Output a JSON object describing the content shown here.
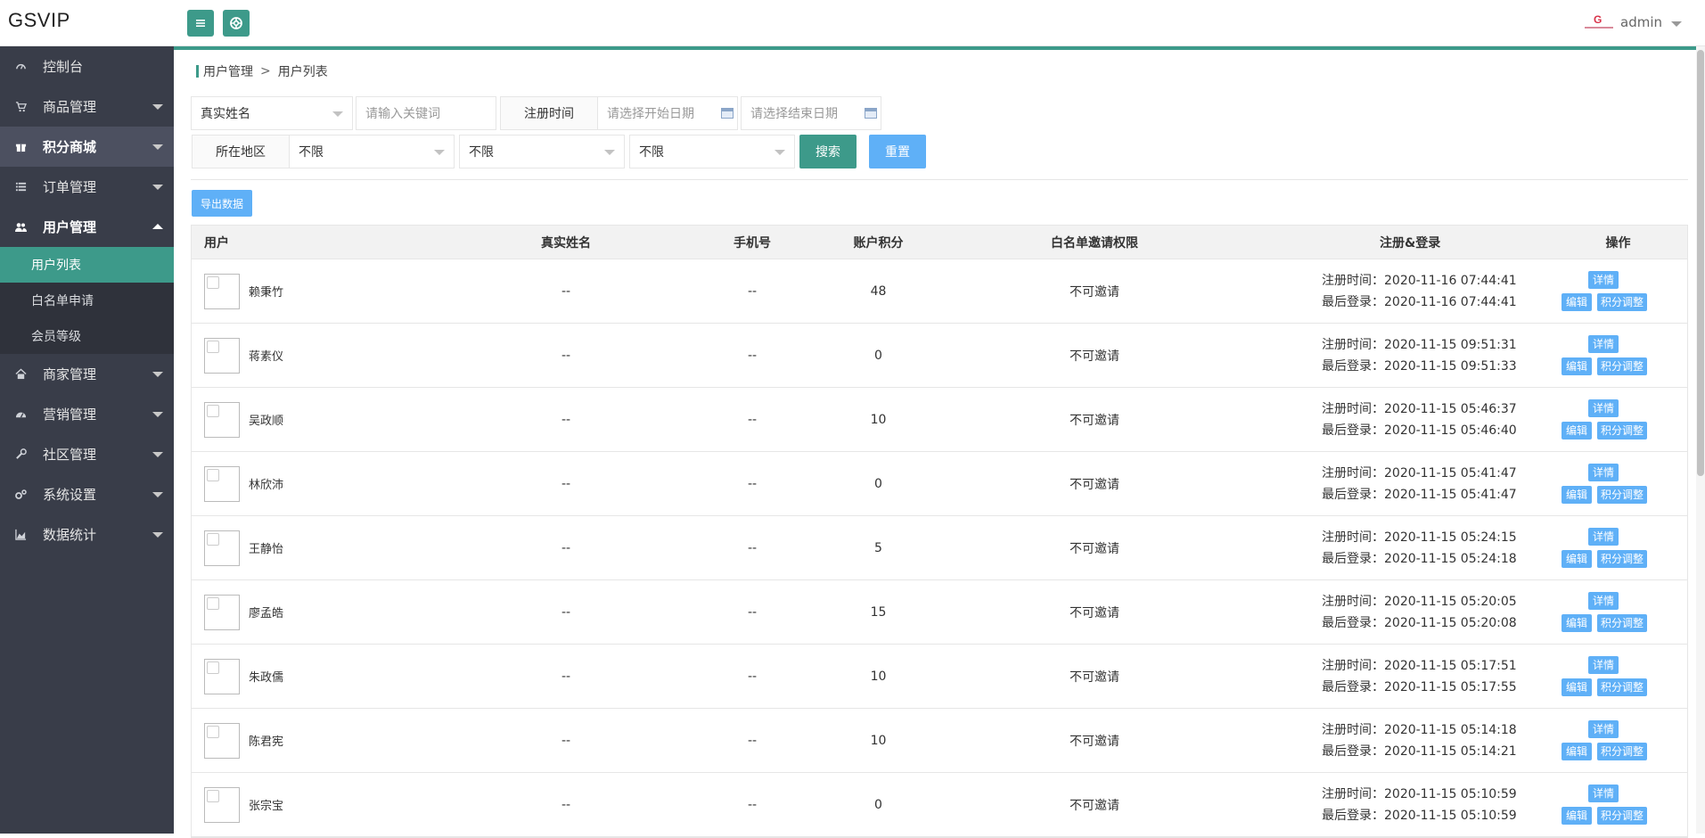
{
  "app": {
    "logo": "GSVIP",
    "user": "admin"
  },
  "sidebar": {
    "items": [
      {
        "label": "控制台",
        "icon": "dashboard-icon",
        "expandable": false
      },
      {
        "label": "商品管理",
        "icon": "cart-icon",
        "expandable": true
      },
      {
        "label": "积分商城",
        "icon": "gift-icon",
        "expandable": true
      },
      {
        "label": "订单管理",
        "icon": "list-icon",
        "expandable": true
      },
      {
        "label": "用户管理",
        "icon": "users-icon",
        "expandable": true,
        "open": true,
        "children": [
          "用户列表",
          "白名单申请",
          "会员等级"
        ]
      },
      {
        "label": "商家管理",
        "icon": "home-icon",
        "expandable": true
      },
      {
        "label": "营销管理",
        "icon": "gauge-icon",
        "expandable": true
      },
      {
        "label": "社区管理",
        "icon": "wrench-icon",
        "expandable": true
      },
      {
        "label": "系统设置",
        "icon": "gears-icon",
        "expandable": true
      },
      {
        "label": "数据统计",
        "icon": "area-chart-icon",
        "expandable": true
      }
    ]
  },
  "breadcrumb": {
    "parent": "用户管理",
    "sep": ">",
    "current": "用户列表"
  },
  "filters": {
    "field_select": "真实姓名",
    "keyword_placeholder": "请输入关键词",
    "reg_time_label": "注册时间",
    "start_date_placeholder": "请选择开始日期",
    "end_date_placeholder": "请选择结束日期",
    "region_label": "所在地区",
    "province": "不限",
    "city": "不限",
    "district": "不限",
    "search_button": "搜索",
    "reset_button": "重置"
  },
  "export_button": "导出数据",
  "table": {
    "headers": {
      "user": "用户",
      "name": "真实姓名",
      "phone": "手机号",
      "points": "账户积分",
      "perm": "白名单邀请权限",
      "reg": "注册&登录",
      "op": "操作"
    },
    "reg_prefix": "注册时间：",
    "login_prefix": "最后登录：",
    "op_detail": "详情",
    "op_edit": "编辑",
    "op_points": "积分调整",
    "rows": [
      {
        "user": "赖秉竹",
        "name": "--",
        "phone": "--",
        "points": "48",
        "perm": "不可邀请",
        "reg": "2020-11-16 07:44:41",
        "login": "2020-11-16 07:44:41"
      },
      {
        "user": "蒋素仪",
        "name": "--",
        "phone": "--",
        "points": "0",
        "perm": "不可邀请",
        "reg": "2020-11-15 09:51:31",
        "login": "2020-11-15 09:51:33"
      },
      {
        "user": "吴政顺",
        "name": "--",
        "phone": "--",
        "points": "10",
        "perm": "不可邀请",
        "reg": "2020-11-15 05:46:37",
        "login": "2020-11-15 05:46:40"
      },
      {
        "user": "林欣沛",
        "name": "--",
        "phone": "--",
        "points": "0",
        "perm": "不可邀请",
        "reg": "2020-11-15 05:41:47",
        "login": "2020-11-15 05:41:47"
      },
      {
        "user": "王静怡",
        "name": "--",
        "phone": "--",
        "points": "5",
        "perm": "不可邀请",
        "reg": "2020-11-15 05:24:15",
        "login": "2020-11-15 05:24:18"
      },
      {
        "user": "廖孟皓",
        "name": "--",
        "phone": "--",
        "points": "15",
        "perm": "不可邀请",
        "reg": "2020-11-15 05:20:05",
        "login": "2020-11-15 05:20:08"
      },
      {
        "user": "朱政儒",
        "name": "--",
        "phone": "--",
        "points": "10",
        "perm": "不可邀请",
        "reg": "2020-11-15 05:17:51",
        "login": "2020-11-15 05:17:55"
      },
      {
        "user": "陈君宪",
        "name": "--",
        "phone": "--",
        "points": "10",
        "perm": "不可邀请",
        "reg": "2020-11-15 05:14:18",
        "login": "2020-11-15 05:14:21"
      },
      {
        "user": "张宗宝",
        "name": "--",
        "phone": "--",
        "points": "0",
        "perm": "不可邀请",
        "reg": "2020-11-15 05:10:59",
        "login": "2020-11-15 05:10:59"
      }
    ]
  },
  "colors": {
    "accent": "#3d9a8a",
    "sidebar": "#393d49",
    "button_blue": "#5fb0f7"
  }
}
